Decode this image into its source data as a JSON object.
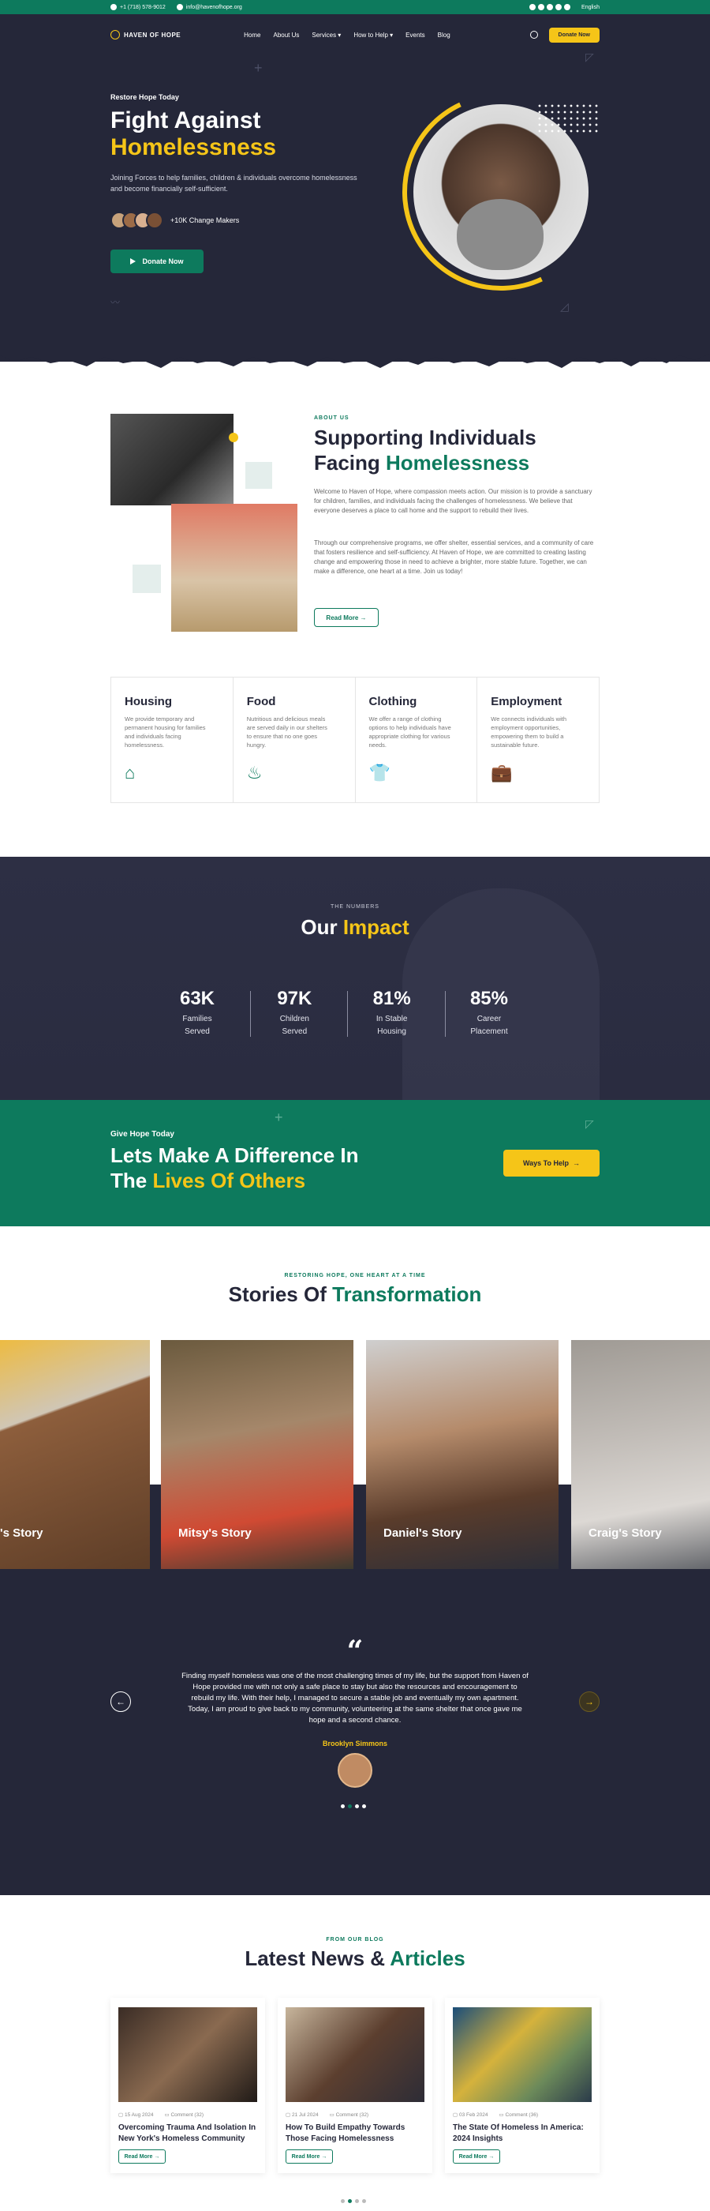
{
  "topbar": {
    "phone": "+1 (718) 578-9012",
    "email": "info@havenofhope.org",
    "language": "English"
  },
  "nav": {
    "logo": "HAVEN OF HOPE",
    "items": [
      "Home",
      "About Us",
      "Services",
      "How to Help",
      "Events",
      "Blog"
    ],
    "donate": "Donate Now"
  },
  "hero": {
    "eyebrow": "Restore Hope Today",
    "title_line1": "Fight Against",
    "title_line2": "Homelessness",
    "description": "Joining Forces to help families, children & individuals overcome homelessness and become financially self-sufficient.",
    "makers": "+10K Change Makers",
    "button": "Donate Now"
  },
  "about": {
    "eyebrow": "ABOUT US",
    "title_a": "Supporting Individuals",
    "title_b": "Facing ",
    "title_c": "Homelessness",
    "p1": "Welcome to Haven of Hope, where compassion meets action. Our mission is to provide a sanctuary for children, families, and individuals facing the challenges of homelessness. We believe that everyone deserves a place to call home and the support to rebuild their lives.",
    "p2": "Through our comprehensive programs, we offer shelter, essential services, and a community of care that fosters resilience and self-sufficiency. At Haven of Hope, we are committed to creating lasting change and empowering those in need to achieve a brighter, more stable future. Together, we can make a difference, one heart at a time. Join us today!",
    "button": "Read More"
  },
  "services": [
    {
      "title": "Housing",
      "text": "We provide temporary and permanent housing for families and individuals facing homelessness.",
      "icon": "house-icon"
    },
    {
      "title": "Food",
      "text": "Nutritious and delicious meals are served daily in our shelters to ensure that no one goes hungry.",
      "icon": "food-icon"
    },
    {
      "title": "Clothing",
      "text": "We offer a range of clothing options to help individuals have appropriate clothing for various needs.",
      "icon": "shirt-icon"
    },
    {
      "title": "Employment",
      "text": "We connects individuals with employment opportunities, empowering them to build a sustainable future.",
      "icon": "briefcase-icon"
    }
  ],
  "impact": {
    "eyebrow": "THE NUMBERS",
    "title_a": "Our ",
    "title_b": "Impact",
    "stats": [
      {
        "num": "63K",
        "l1": "Families",
        "l2": "Served"
      },
      {
        "num": "97K",
        "l1": "Children",
        "l2": "Served"
      },
      {
        "num": "81%",
        "l1": "In Stable",
        "l2": "Housing"
      },
      {
        "num": "85%",
        "l1": "Career",
        "l2": "Placement"
      }
    ]
  },
  "cta": {
    "eyebrow": "Give Hope Today",
    "line1": "Lets Make A Difference In",
    "line2a": "The ",
    "line2b": "Lives Of Others",
    "button": "Ways To Help"
  },
  "stories": {
    "eyebrow": "RESTORING HOPE, ONE HEART AT A TIME",
    "title_a": "Stories Of ",
    "title_b": "Transformation",
    "items": [
      "'s Story",
      "Mitsy's Story",
      "Daniel's Story",
      "Craig's Story"
    ]
  },
  "testimonial": {
    "text": "Finding myself homeless was one of the most challenging times of my life, but the support from Haven of Hope provided me with not only a safe place to stay but also the resources and encouragement to rebuild my life. With their help, I managed to secure a stable job and eventually my own apartment. Today, I am proud to give back to my community, volunteering at the same shelter that once gave me hope and a second chance.",
    "author": "Brooklyn Simmons"
  },
  "news": {
    "eyebrow": "FROM OUR BLOG",
    "title_a": "Latest News & ",
    "title_b": "Articles",
    "cards": [
      {
        "date": "15 Aug 2024",
        "comments": "Comment (32)",
        "title": "Overcoming Trauma And Isolation In New York's Homeless Community",
        "button": "Read More"
      },
      {
        "date": "21 Jul 2024",
        "comments": "Comment (32)",
        "title": "How To Build Empathy Towards Those Facing Homelessness",
        "button": "Read More"
      },
      {
        "date": "03 Feb 2024",
        "comments": "Comment (36)",
        "title": "The State Of Homeless In America: 2024 Insights",
        "button": "Read More"
      }
    ]
  }
}
